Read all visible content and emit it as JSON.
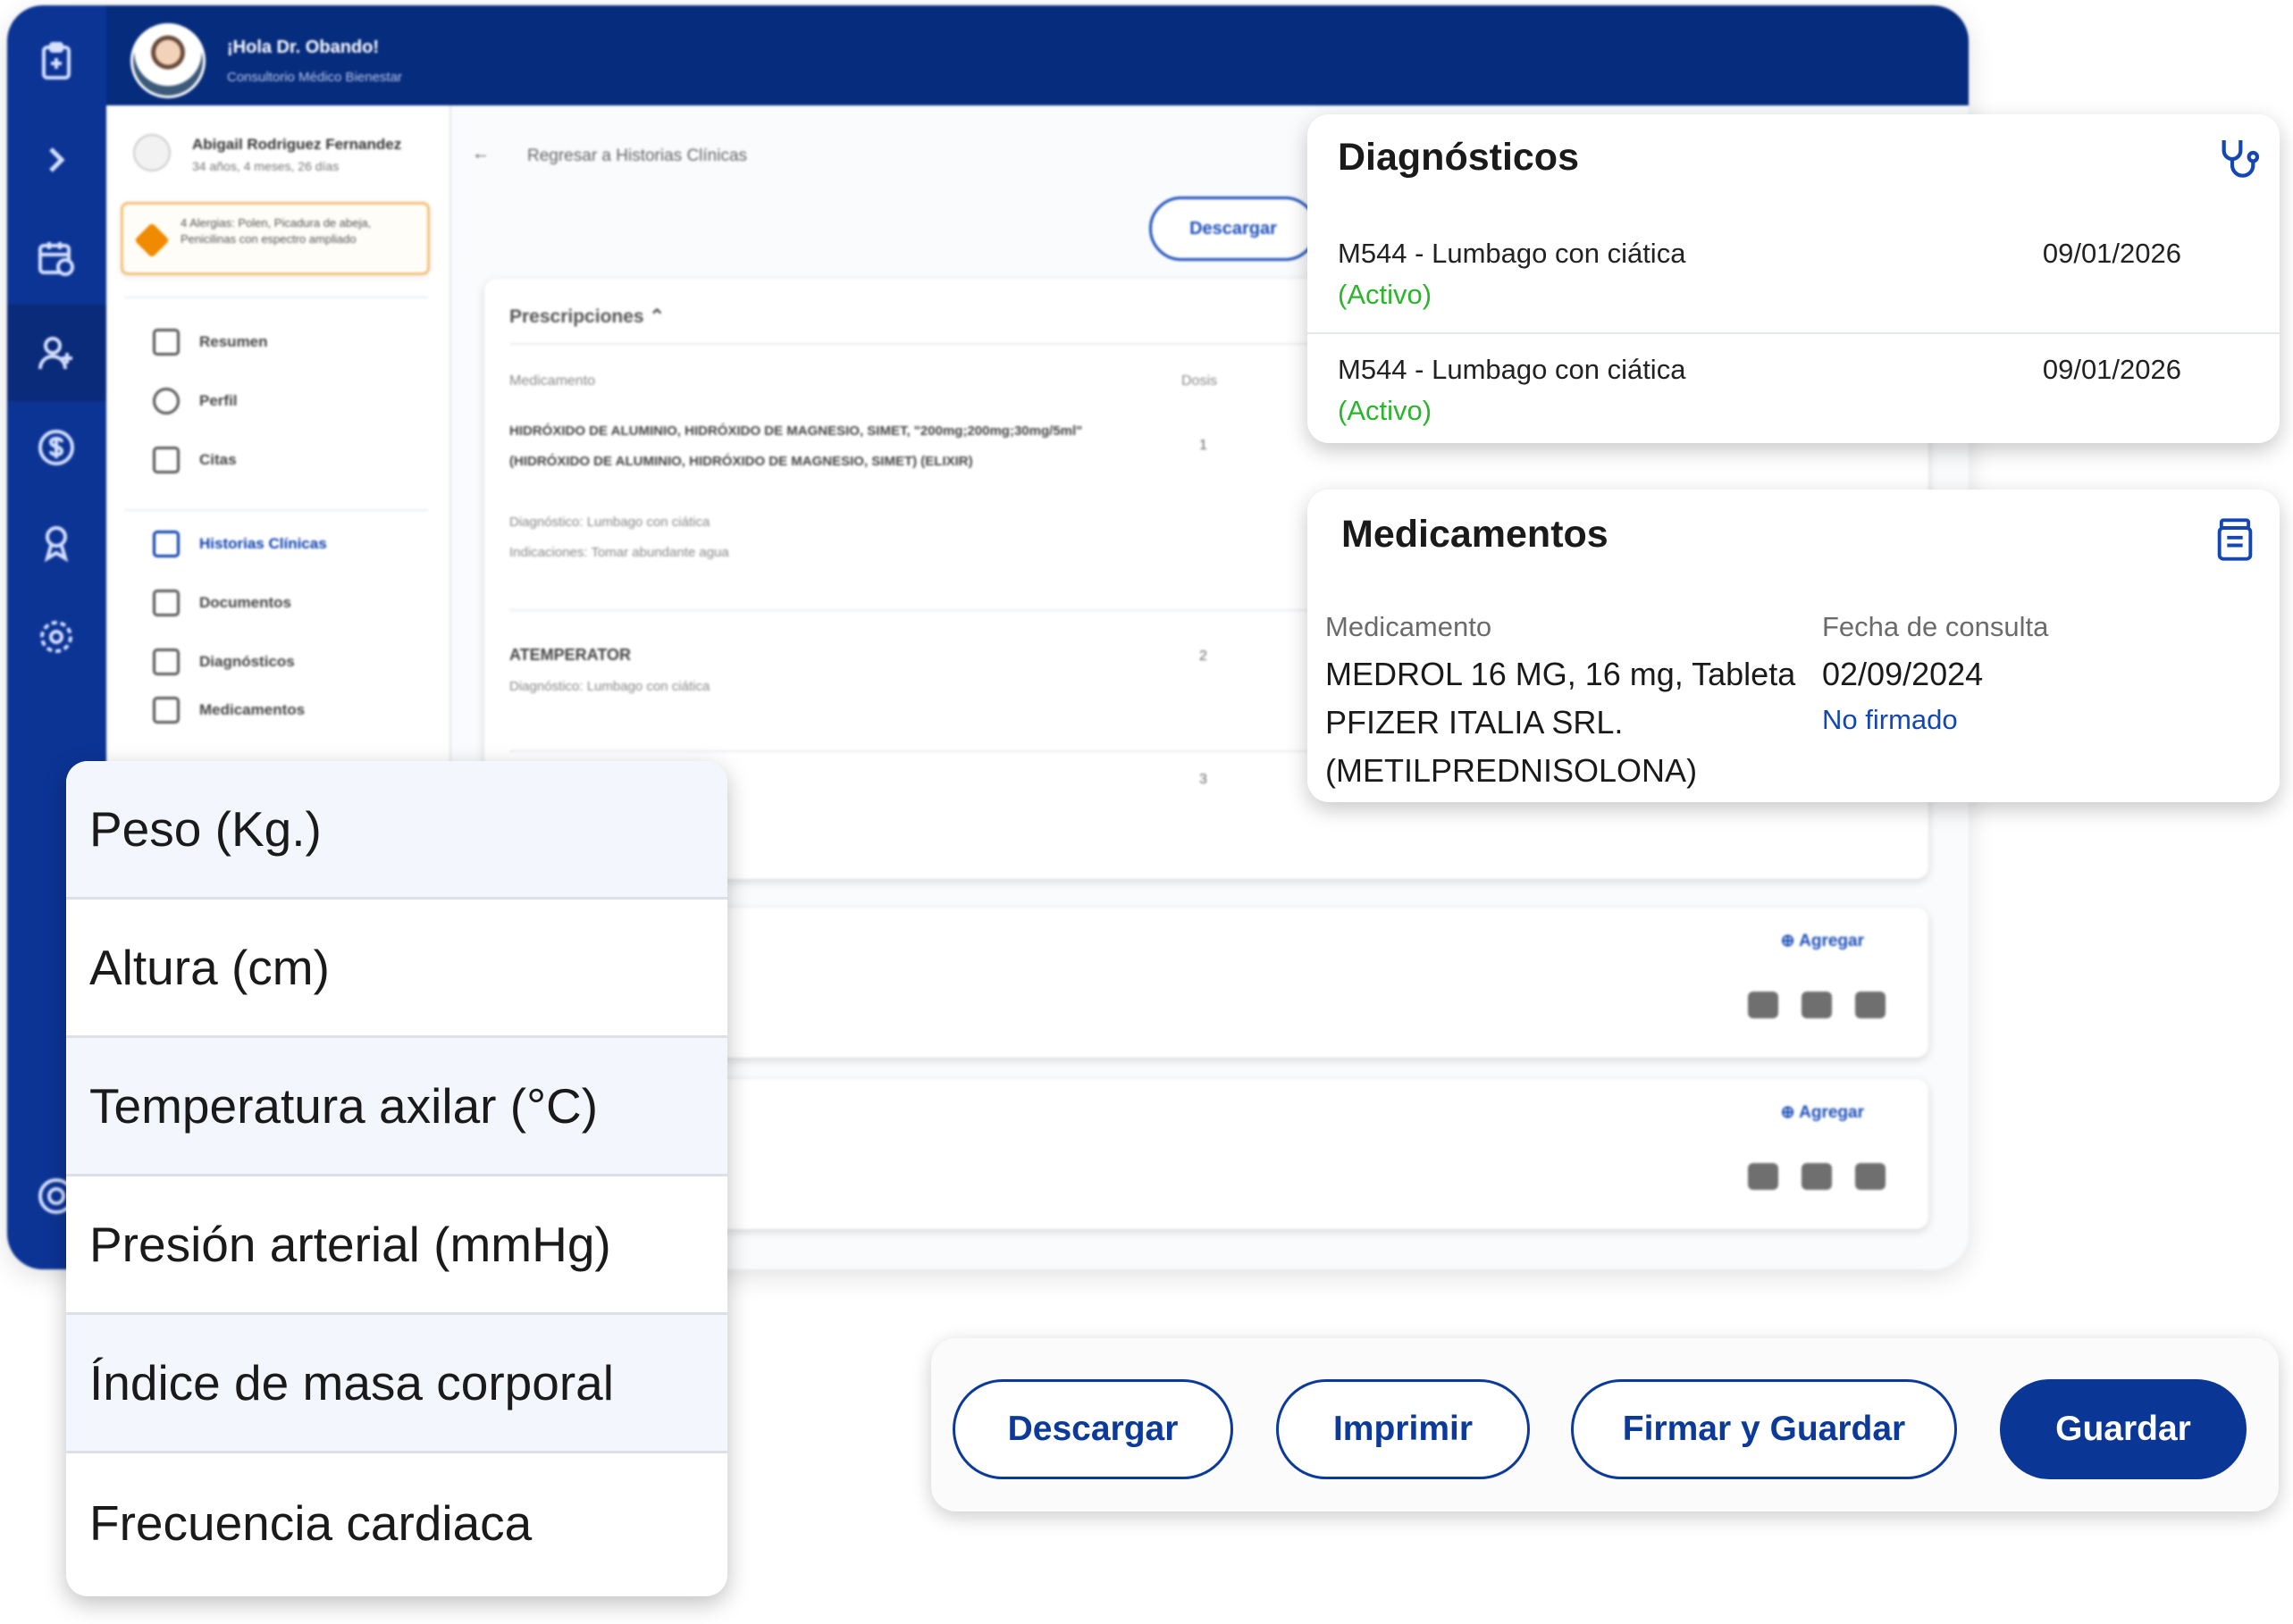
{
  "header": {
    "greeting": "¡Hola Dr. Obando!",
    "clinic": "Consultorio Médico Bienestar"
  },
  "patient": {
    "name": "Abigail Rodriguez Fernandez",
    "age": "34 años, 4 meses, 26 días",
    "allergies": "4 Alergias: Polen, Picadura de abeja, Penicilinas con espectro ampliado"
  },
  "sidebar": {
    "items": [
      {
        "label": "Resumen",
        "icon": "grid-icon"
      },
      {
        "label": "Perfil",
        "icon": "person-icon"
      },
      {
        "label": "Citas",
        "icon": "calendar-icon"
      },
      {
        "label": "Historias Clínicas",
        "icon": "clipboard-icon"
      },
      {
        "label": "Documentos",
        "icon": "folder-icon"
      },
      {
        "label": "Diagnósticos",
        "icon": "clipboard-icon"
      },
      {
        "label": "Medicamentos",
        "icon": "folder-icon"
      }
    ]
  },
  "main": {
    "back_label": "Regresar a Historias Clínicas",
    "download_label": "Descargar",
    "prescriptions": {
      "title": "Prescripciones",
      "col_med": "Medicamento",
      "col_dose": "Dosis",
      "rows": [
        {
          "name": "HIDRÓXIDO DE ALUMINIO, HIDRÓXIDO DE MAGNESIO, SIMET, \"200mg;200mg;30mg/5ml\" (HIDRÓXIDO DE ALUMINIO, HIDRÓXIDO DE MAGNESIO, SIMET) (ELIXIR)",
          "diagnosis": "Diagnóstico: Lumbago con ciática",
          "indications": "Indicaciones: Tomar abundante agua",
          "dose": "1"
        },
        {
          "name": "ATEMPERATOR",
          "diagnosis": "Diagnóstico: Lumbago con ciática",
          "dose": "2"
        },
        {
          "dose": "3"
        }
      ]
    },
    "add_label": "Agregar"
  },
  "diagnosticos": {
    "title": "Diagnósticos",
    "items": [
      {
        "code": "M544 - Lumbago con ciática",
        "status": "(Activo)",
        "date": "09/01/2026"
      },
      {
        "code": "M544 - Lumbago con ciática",
        "status": "(Activo)",
        "date": "09/01/2026"
      }
    ]
  },
  "medicamentos": {
    "title": "Medicamentos",
    "col_med": "Medicamento",
    "col_date": "Fecha de consulta",
    "med_line1": "MEDROL 16 MG, 16 mg, Tableta",
    "med_line2": "PFIZER ITALIA SRL.",
    "med_line3": "(METILPREDNISOLONA)",
    "date": "02/09/2024",
    "status": "No firmado"
  },
  "vitals": {
    "items": [
      "Peso (Kg.)",
      "Altura (cm)",
      "Temperatura axilar (°C)",
      "Presión arterial (mmHg)",
      "Índice de masa corporal",
      "Frecuencia cardiaca"
    ]
  },
  "actions": {
    "download": "Descargar",
    "print": "Imprimir",
    "sign_save": "Firmar y Guardar",
    "save": "Guardar"
  },
  "colors": {
    "brand_dark": "#062c7d",
    "brand": "#0a3696",
    "active_green": "#2bb52b",
    "link_blue": "#1447b3"
  }
}
